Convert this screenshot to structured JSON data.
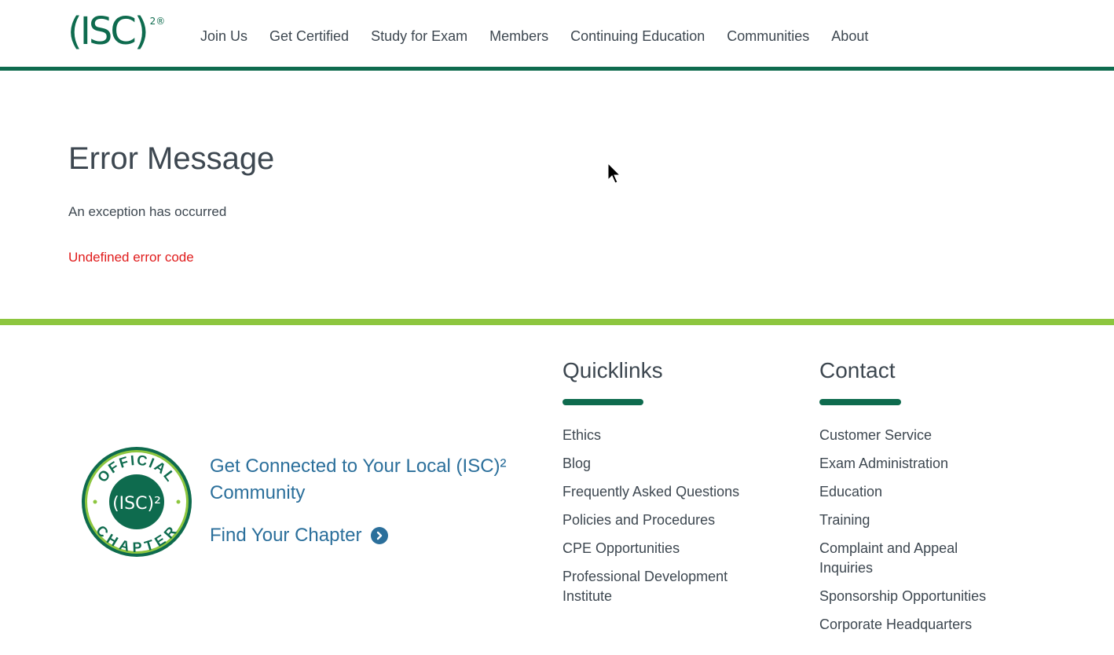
{
  "header": {
    "logo_text": "(ISC)",
    "logo_sup": "2®",
    "nav": [
      "Join Us",
      "Get Certified",
      "Study for Exam",
      "Members",
      "Continuing Education",
      "Communities",
      "About"
    ]
  },
  "main": {
    "title": "Error Message",
    "message": "An exception has occurred",
    "error": "Undefined error code"
  },
  "footer": {
    "community_title": "Get Connected to Your Local (ISC)² Community",
    "find_chapter": "Find Your Chapter",
    "badge": {
      "top_text": "OFFICIAL",
      "center_text": "(ISC)²",
      "bottom_text": "CHAPTER"
    },
    "quicklinks": {
      "title": "Quicklinks",
      "items": [
        "Ethics",
        "Blog",
        "Frequently Asked Questions",
        "Policies and Procedures",
        "CPE Opportunities",
        "Professional Development Institute"
      ]
    },
    "contact": {
      "title": "Contact",
      "items": [
        "Customer Service",
        "Exam Administration",
        "Education",
        "Training",
        "Complaint and Appeal Inquiries",
        "Sponsorship Opportunities",
        "Corporate Headquarters"
      ]
    }
  },
  "colors": {
    "brand_green": "#0e6b4e",
    "accent_green": "#8dc63f",
    "link_blue": "#2b6f9b",
    "error_red": "#e01b1b"
  }
}
